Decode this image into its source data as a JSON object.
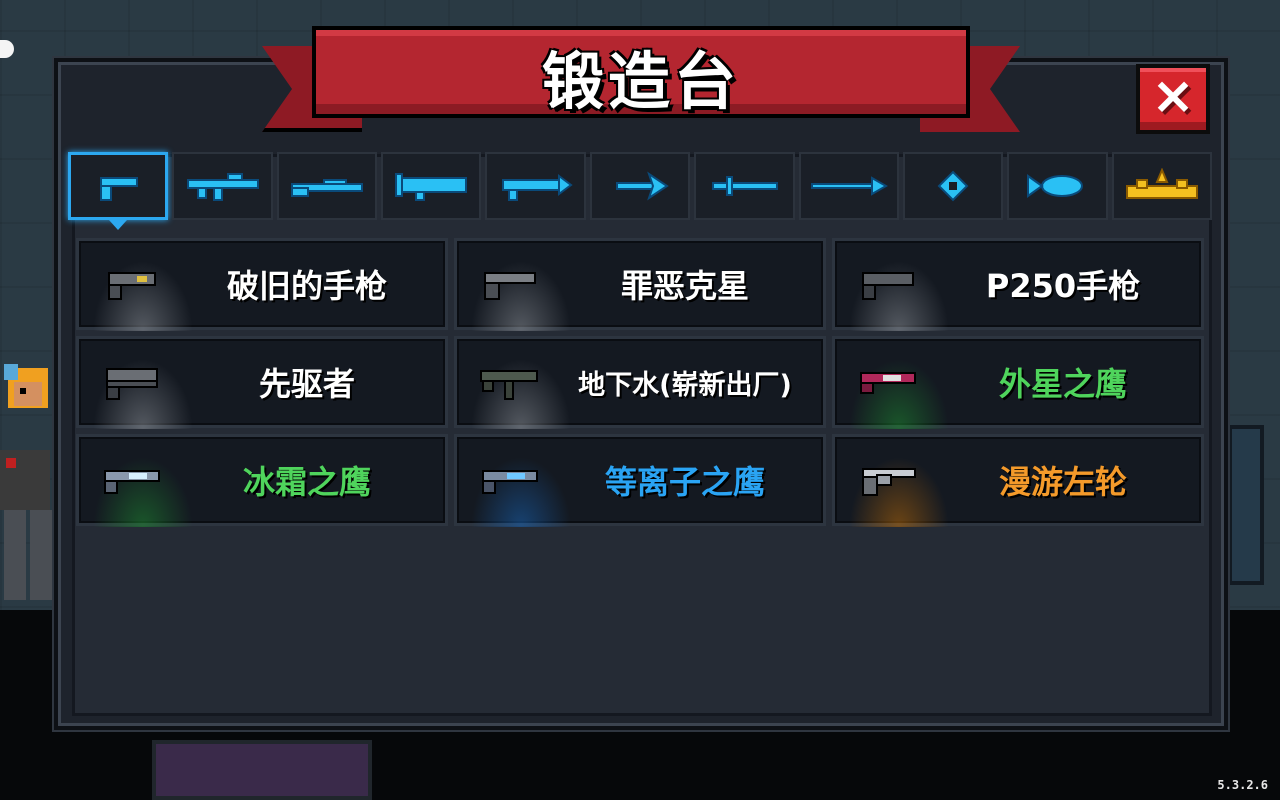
{
  "title": "锻造台",
  "close_icon": "×",
  "version": "5.3.2.6",
  "tabs": [
    {
      "icon": "pistol-icon",
      "active": true
    },
    {
      "icon": "rifle-icon",
      "active": false
    },
    {
      "icon": "shotgun-icon",
      "active": false
    },
    {
      "icon": "launcher-icon",
      "active": false
    },
    {
      "icon": "laser-gun-icon",
      "active": false
    },
    {
      "icon": "bow-icon",
      "active": false
    },
    {
      "icon": "sword-icon",
      "active": false
    },
    {
      "icon": "spear-icon",
      "active": false
    },
    {
      "icon": "shuriken-icon",
      "active": false
    },
    {
      "icon": "fish-icon",
      "active": false
    },
    {
      "icon": "special-gold-icon",
      "active": false
    }
  ],
  "weapons": [
    {
      "name": "破旧的手枪",
      "color": "#ffffff",
      "glow": "#8a8f96"
    },
    {
      "name": "罪恶克星",
      "color": "#ffffff",
      "glow": "#8a8f96"
    },
    {
      "name": "P250手枪",
      "color": "#ffffff",
      "glow": "#8a8f96"
    },
    {
      "name": "先驱者",
      "color": "#ffffff",
      "glow": "#8a8f96"
    },
    {
      "name": "地下水(崭新出厂)",
      "color": "#ffffff",
      "glow": "#8a8f96"
    },
    {
      "name": "外星之鹰",
      "color": "#4fd45c",
      "glow": "#1f8a32"
    },
    {
      "name": "冰霜之鹰",
      "color": "#4fd45c",
      "glow": "#1f8a32"
    },
    {
      "name": "等离子之鹰",
      "color": "#2aa4f4",
      "glow": "#1a64b4"
    },
    {
      "name": "漫游左轮",
      "color": "#f49a2a",
      "glow": "#b4680a"
    }
  ],
  "colors": {
    "accent": "#2ca8f0",
    "ribbon": "#b42630",
    "close": "#d6262c"
  }
}
